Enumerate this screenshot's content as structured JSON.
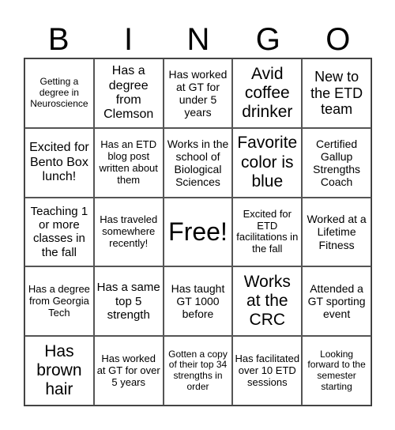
{
  "header": {
    "letters": [
      "B",
      "I",
      "N",
      "G",
      "O"
    ]
  },
  "grid": {
    "rows": [
      [
        "Getting a degree in Neuroscience",
        "Has a degree from Clemson",
        "Has worked at GT for under 5 years",
        "Avid coffee drinker",
        "New to the ETD team"
      ],
      [
        "Excited for Bento Box lunch!",
        "Has an ETD blog post written about them",
        "Works in the school of Biological Sciences",
        "Favorite color is blue",
        "Certified Gallup Strengths Coach"
      ],
      [
        "Teaching 1 or more classes in the fall",
        "Has traveled somewhere recently!",
        "Free!",
        "Excited for ETD facilitations in the fall",
        "Worked at a Lifetime Fitness"
      ],
      [
        "Has a degree from Georgia Tech",
        "Has a same top 5 strength",
        "Has taught GT 1000 before",
        "Works at the CRC",
        "Attended a GT sporting event"
      ],
      [
        "Has brown hair",
        "Has worked at GT for over 5 years",
        "Gotten a copy of their top 34 strengths in order",
        "Has facilitated over 10 ETD sessions",
        "Looking forward to the semester starting"
      ]
    ]
  }
}
